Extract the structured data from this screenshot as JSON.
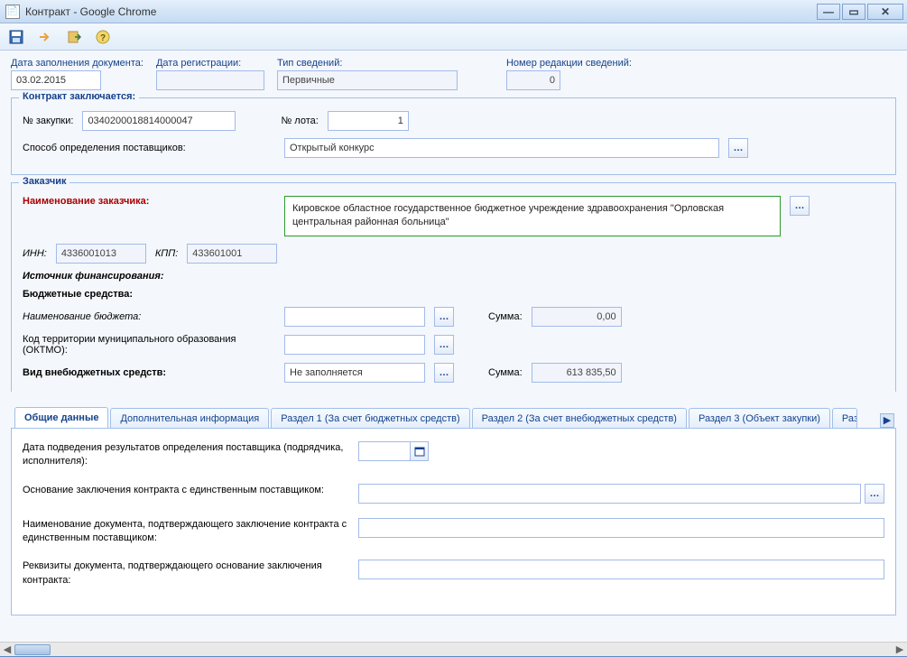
{
  "window_title": "Контракт - Google Chrome",
  "header": {
    "doc_date_label": "Дата заполнения документа:",
    "doc_date_value": "03.02.2015",
    "reg_date_label": "Дата регистрации:",
    "reg_date_value": "",
    "info_type_label": "Тип сведений:",
    "info_type_value": "Первичные",
    "revision_label": "Номер редакции сведений:",
    "revision_value": "0"
  },
  "contract_group": {
    "title": "Контракт заключается:",
    "purchase_no_label": "№ закупки:",
    "purchase_no_value": "0340200018814000047",
    "lot_no_label": "№ лота:",
    "lot_no_value": "1",
    "supplier_method_label": "Способ определения поставщиков:",
    "supplier_method_value": "Открытый конкурс"
  },
  "customer_group": {
    "title": "Заказчик",
    "customer_name_label": "Наименование заказчика:",
    "customer_name_value": "Кировское областное государственное бюджетное учреждение здравоохранения \"Орловская центральная районная больница\"",
    "inn_label": "ИНН:",
    "inn_value": "4336001013",
    "kpp_label": "КПП:",
    "kpp_value": "433601001",
    "funding_source_label": "Источник финансирования:",
    "budget_funds_label": "Бюджетные средства:",
    "budget_name_label": "Наименование бюджета:",
    "budget_name_value": "",
    "budget_sum_label": "Сумма:",
    "budget_sum_value": "0,00",
    "oktmo_label": "Код территории муниципального образования (ОКТМО):",
    "oktmo_value": "",
    "extrabudget_kind_label": "Вид внебюджетных средств:",
    "extrabudget_kind_value": "Не заполняется",
    "extrabudget_sum_label": "Сумма:",
    "extrabudget_sum_value": "613 835,50"
  },
  "tabs": [
    "Общие данные",
    "Дополнительная информация",
    "Раздел 1 (За счет бюджетных средств)",
    "Раздел 2 (За счет внебюджетных средств)",
    "Раздел 3 (Объект закупки)",
    "Раз"
  ],
  "general_tab": {
    "result_date_label": "Дата подведения результатов определения поставщика (подрядчика, исполнителя):",
    "result_date_value": "",
    "single_supplier_basis_label": "Основание заключения контракта с единственным поставщиком:",
    "single_supplier_basis_value": "",
    "doc_name_label": "Наименование документа, подтверждающего заключение контракта с единственным поставщиком:",
    "doc_name_value": "",
    "doc_req_label": "Реквизиты документа, подтверждающего основание заключения контракта:",
    "doc_req_value": ""
  },
  "icons": {
    "save": "save-icon",
    "next": "next-icon",
    "export": "export-icon",
    "help": "help-icon"
  }
}
